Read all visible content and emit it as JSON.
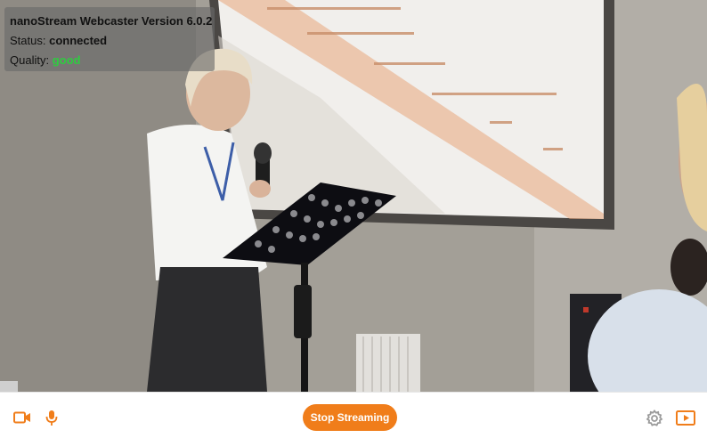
{
  "app": {
    "title": "nanoStream Webcaster Version 6.0.2"
  },
  "status": {
    "label": "Status:",
    "value": "connected"
  },
  "quality": {
    "label": "Quality:",
    "value": "good",
    "color": "#2ecc40"
  },
  "controls": {
    "camera_icon": "video-camera-icon",
    "mic_icon": "microphone-icon",
    "stop_label": "Stop Streaming",
    "settings_icon": "gear-icon",
    "preview_icon": "play-screen-icon",
    "accent": "#f07d1a"
  }
}
